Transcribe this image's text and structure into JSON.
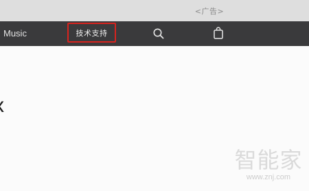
{
  "top_bar": {
    "ad_label": "<广告>"
  },
  "nav": {
    "music_label": "Music",
    "support_label": "技术支持",
    "search_icon": "search-icon",
    "bag_icon": "shopping-bag-icon",
    "highlight_color": "#d9231e"
  },
  "content": {
    "partial_glyph": "x"
  },
  "watermark": {
    "brand": "智能家",
    "url": "www.znj.com"
  }
}
